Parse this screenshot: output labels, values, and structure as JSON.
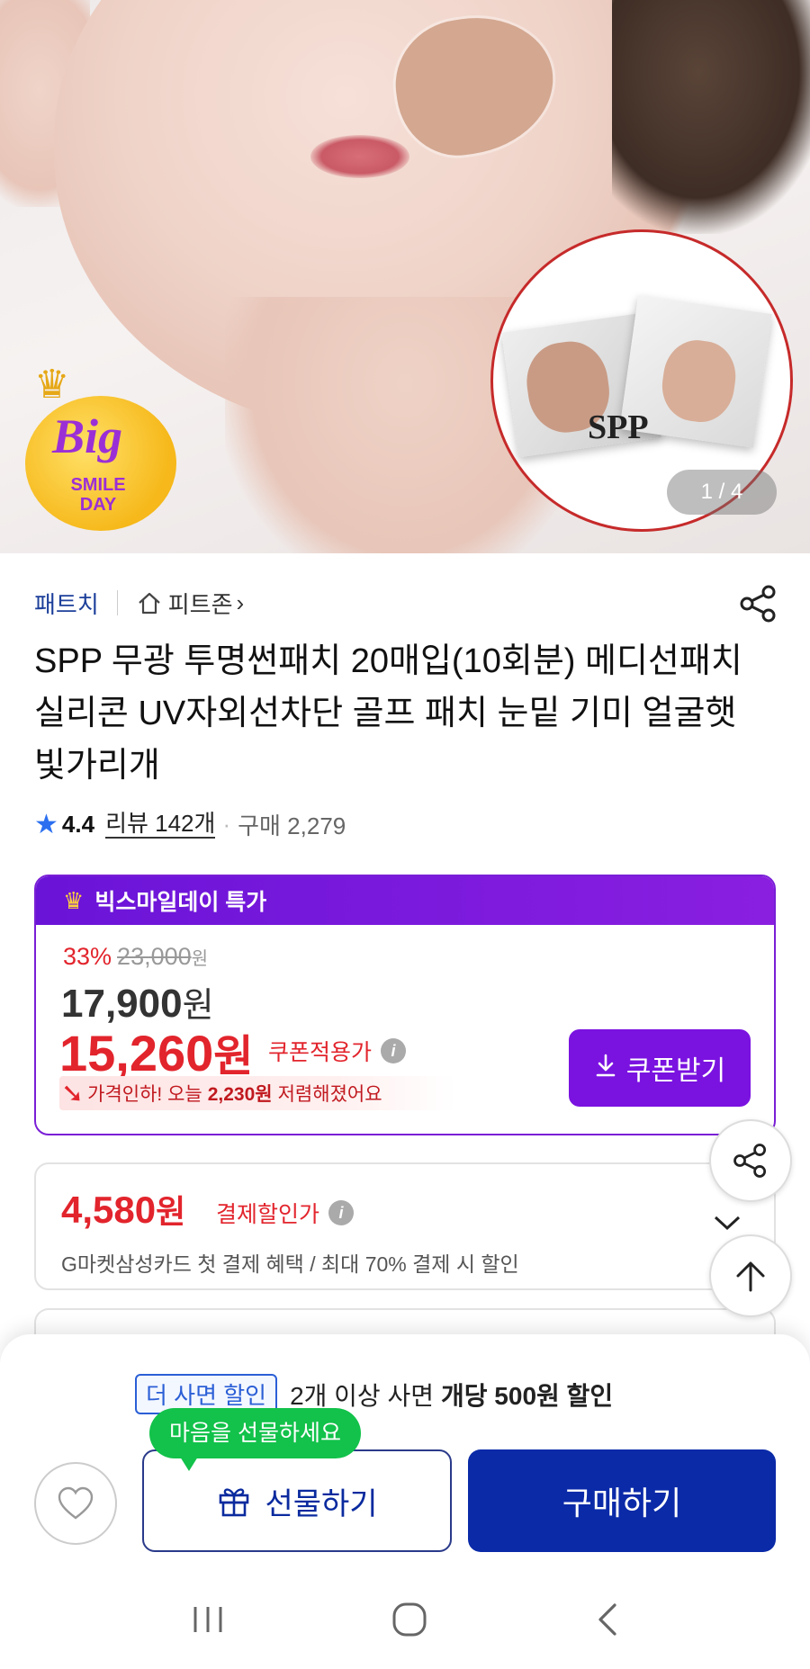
{
  "hero": {
    "badge": {
      "big": "Big",
      "line1": "SMILE",
      "line2": "DAY"
    },
    "inset_brand": "SPP",
    "pager": "1 / 4"
  },
  "breadcrumb": {
    "category": "패트치",
    "store": "피트존",
    "chevron": "›"
  },
  "product": {
    "title": "SPP 무광 투명썬패치 20매입(10회분) 메디선패치 실리콘 UV자외선차단 골프 패치 눈밑 기미 얼굴햇빛가리개",
    "rating": "4.4",
    "reviews": "리뷰 142개",
    "dot": "·",
    "sales": "구매 2,279"
  },
  "deal": {
    "header": "빅스마일데이 특가",
    "discount_pct": "33%",
    "original_price": "23,000",
    "won_small": "원",
    "sale_price": "17,900",
    "won": "원",
    "coupon_price": "15,260",
    "coupon_label": "쿠폰적용가",
    "info": "i",
    "drop_prefix": "가격인하! 오늘",
    "drop_amount": "2,230원",
    "drop_suffix": "저렴해졌어요",
    "coupon_button": "쿠폰받기"
  },
  "card_discount": {
    "amount": "4,580",
    "won": "원",
    "label": "결제할인가",
    "desc": "G마켓삼성카드 첫 결제 혜택 / 최대 70% 결제 시 할인"
  },
  "bottom": {
    "promo_tag": "더 사면 할인",
    "promo_text": "2개 이상 사면",
    "promo_bold": "개당 500원 할인",
    "tooltip": "마음을 선물하세요",
    "gift_button": "선물하기",
    "buy_button": "구매하기"
  },
  "colors": {
    "accent_purple": "#7a12e0",
    "price_red": "#e2242c",
    "buy_blue": "#0a2aa8",
    "tooltip_green": "#12c24a"
  }
}
